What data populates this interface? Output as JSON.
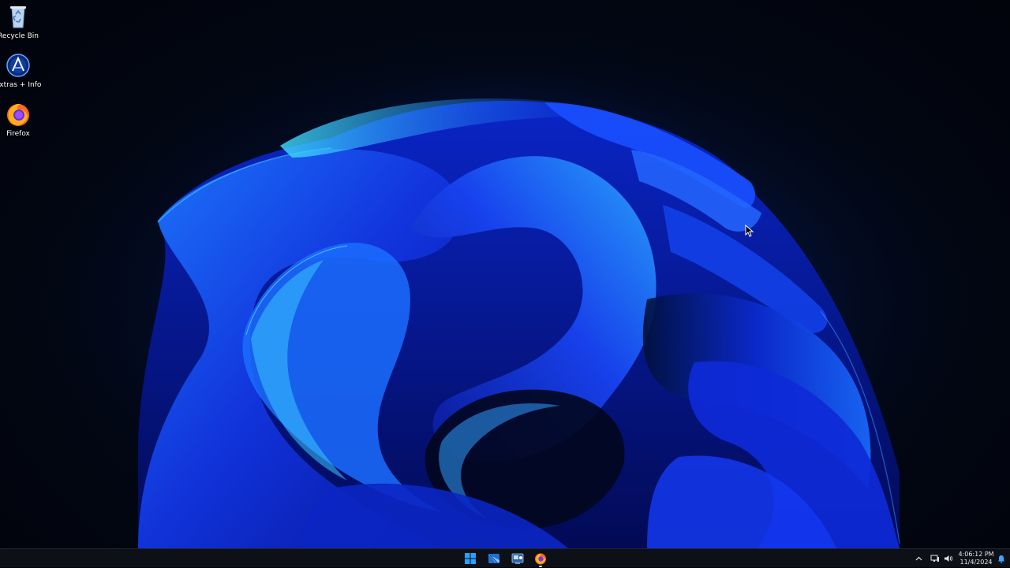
{
  "desktop": {
    "icons": [
      {
        "label": "Recycle Bin",
        "icon": "recycle-bin-icon"
      },
      {
        "label": "Extras + Info",
        "icon": "extras-info-icon"
      },
      {
        "label": "Firefox",
        "icon": "firefox-icon"
      }
    ]
  },
  "taskbar": {
    "pinned": [
      {
        "icon": "windows-start-icon"
      },
      {
        "icon": "explorer-icon"
      },
      {
        "icon": "control-panel-icon"
      },
      {
        "icon": "firefox-icon"
      }
    ],
    "tray": {
      "icons": [
        "chevron-up-icon",
        "network-icon",
        "volume-icon",
        "notification-bell-icon"
      ]
    },
    "clock": {
      "time": "4:06:12 PM",
      "date": "11/4/2024"
    }
  },
  "colors": {
    "accent": "#1a5cff",
    "taskbar_bg": "#0d1117",
    "wallpaper_dark": "#020714"
  }
}
